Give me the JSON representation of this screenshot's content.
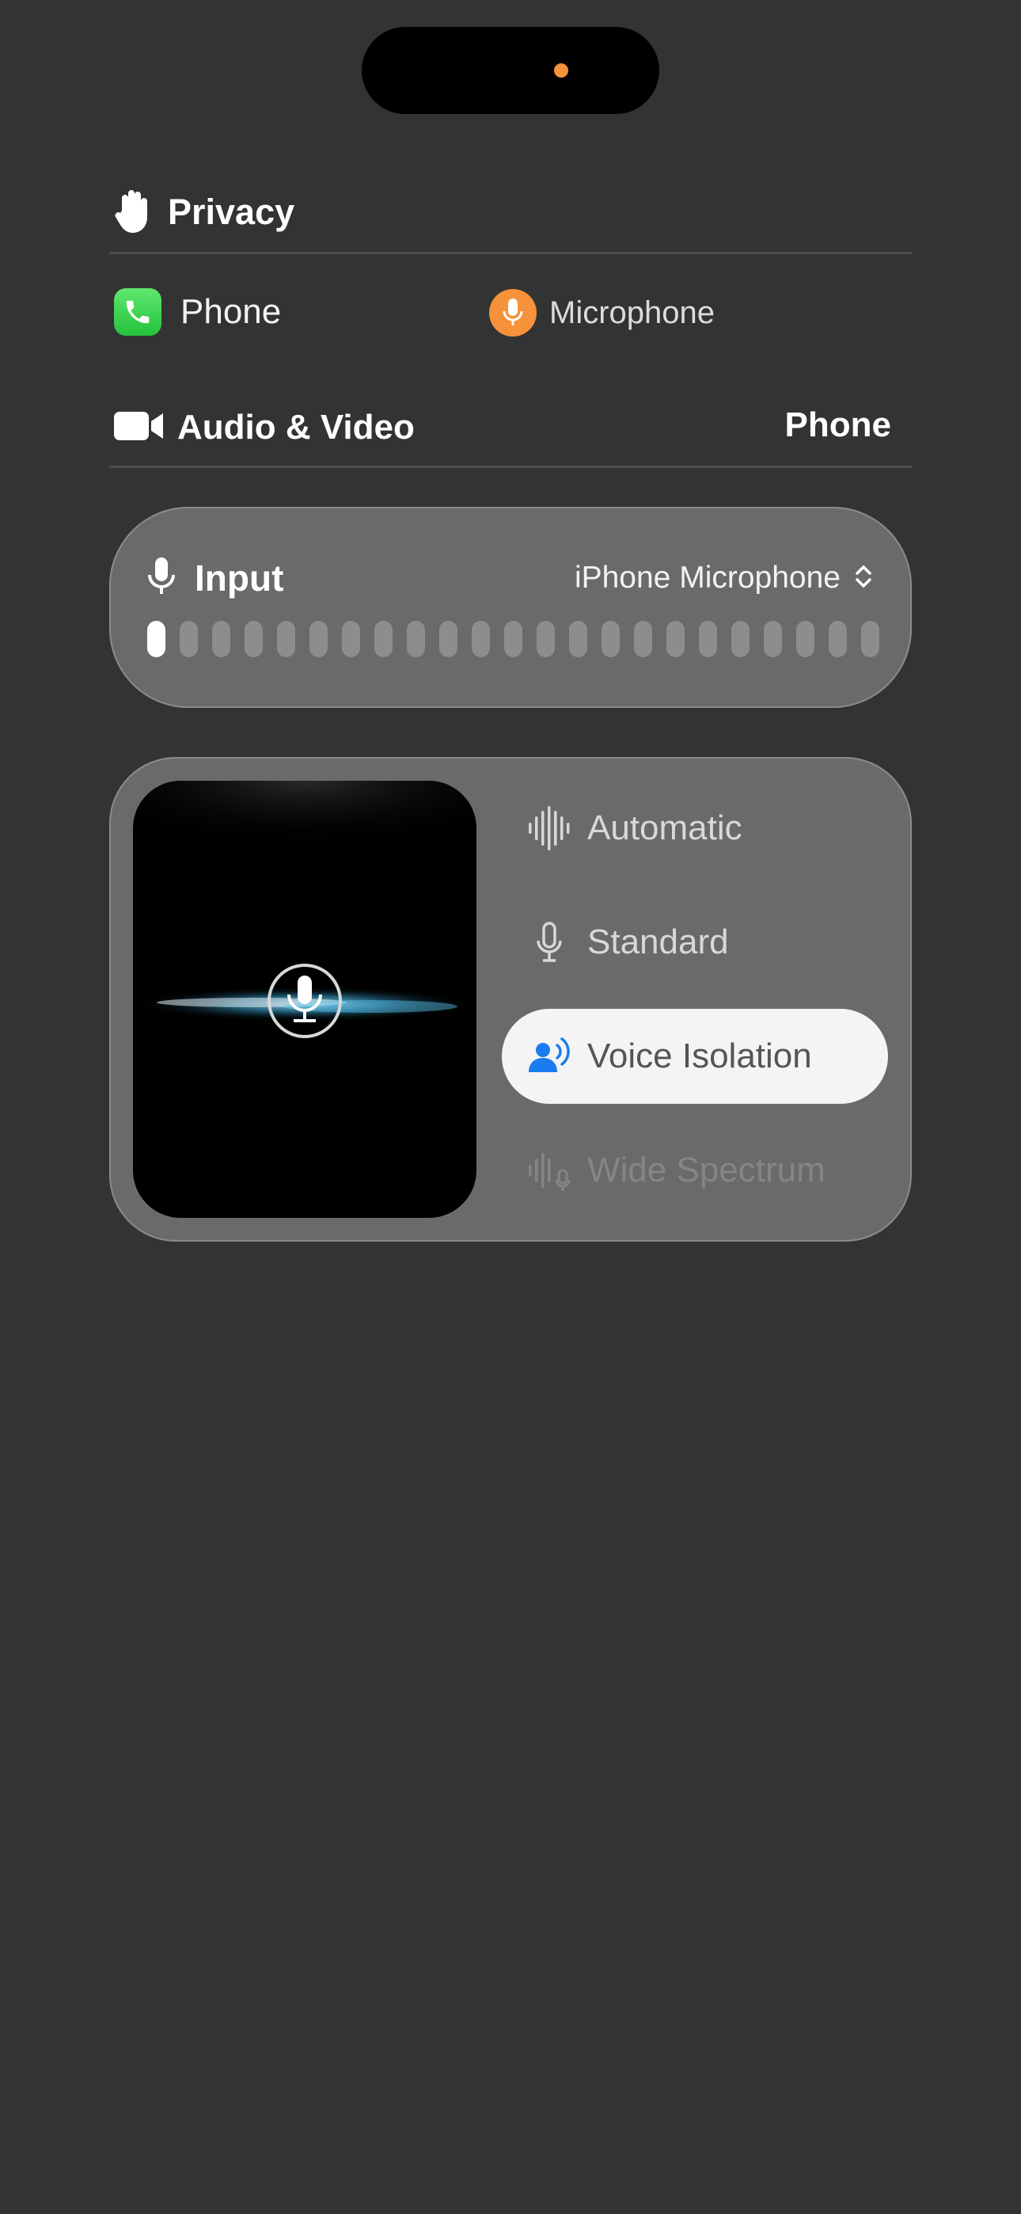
{
  "privacy": {
    "label": "Privacy"
  },
  "active_app": {
    "name": "Phone",
    "resource": "Microphone"
  },
  "audio_video": {
    "label": "Audio & Video",
    "value": "Phone"
  },
  "input": {
    "label": "Input",
    "device": "iPhone Microphone",
    "level_segments_total": 23,
    "level_segments_active": 1
  },
  "mic_modes": {
    "options": [
      {
        "label": "Automatic",
        "icon": "waveform-icon",
        "state": "normal"
      },
      {
        "label": "Standard",
        "icon": "microphone-icon",
        "state": "normal"
      },
      {
        "label": "Voice Isolation",
        "icon": "person-wave-icon",
        "state": "selected"
      },
      {
        "label": "Wide Spectrum",
        "icon": "waveform-mic-icon",
        "state": "disabled"
      }
    ]
  },
  "colors": {
    "background": "#333333",
    "card": "#6a6a6a",
    "accent_orange": "#f5923a",
    "accent_blue": "#1a7cf0",
    "phone_green": "#34c759"
  }
}
